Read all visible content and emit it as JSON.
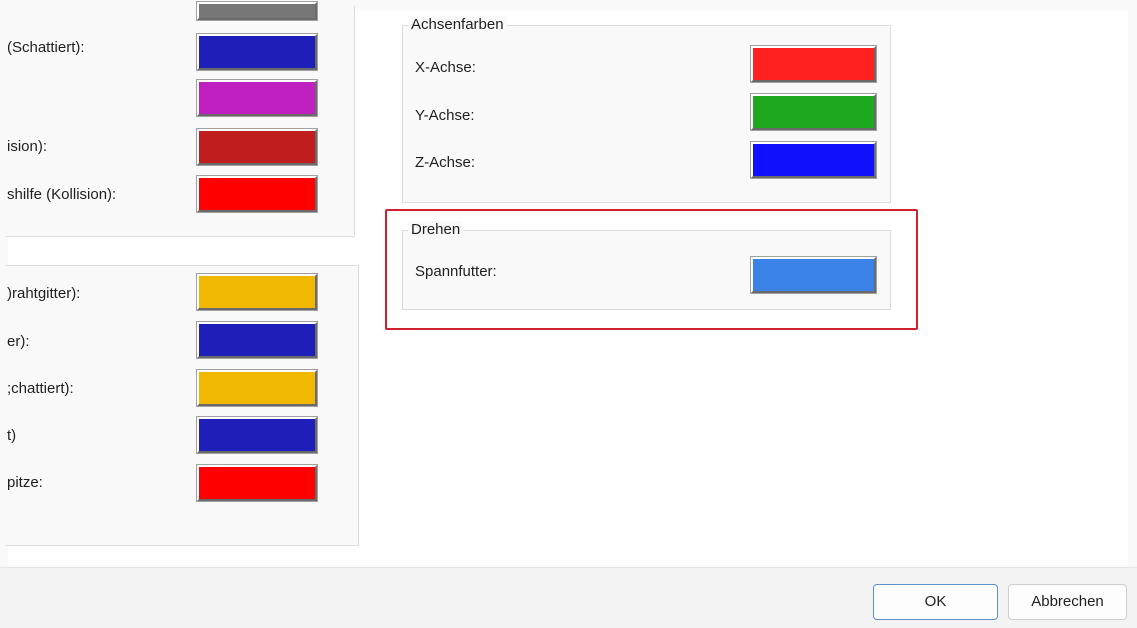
{
  "left_top_group": {
    "rows": [
      {
        "label": "(Schattiert):",
        "color": "#1e1eb8"
      },
      {
        "label": "",
        "color": "#c020c0"
      },
      {
        "label": "ision):",
        "color": "#c01e1e"
      },
      {
        "label": "shilfe (Kollision):",
        "color": "#ff0000"
      }
    ],
    "top_partial_color": "#777777"
  },
  "left_bottom_group": {
    "rows": [
      {
        "label": ")rahtgitter):",
        "color": "#f0b800"
      },
      {
        "label": "er):",
        "color": "#1e1eb8"
      },
      {
        "label": ";chattiert):",
        "color": "#f0b800"
      },
      {
        "label": "t)",
        "color": "#1e1eb8"
      },
      {
        "label": "pitze:",
        "color": "#ff0000"
      }
    ]
  },
  "achsenfarben": {
    "title": "Achsenfarben",
    "rows": [
      {
        "label": "X-Achse:",
        "color": "#ff2020"
      },
      {
        "label": "Y-Achse:",
        "color": "#1ea81e"
      },
      {
        "label": "Z-Achse:",
        "color": "#1010ff"
      }
    ]
  },
  "drehen": {
    "title": "Drehen",
    "rows": [
      {
        "label": "Spannfutter:",
        "color": "#3a82e8"
      }
    ]
  },
  "buttons": {
    "ok": "OK",
    "cancel": "Abbrechen"
  }
}
